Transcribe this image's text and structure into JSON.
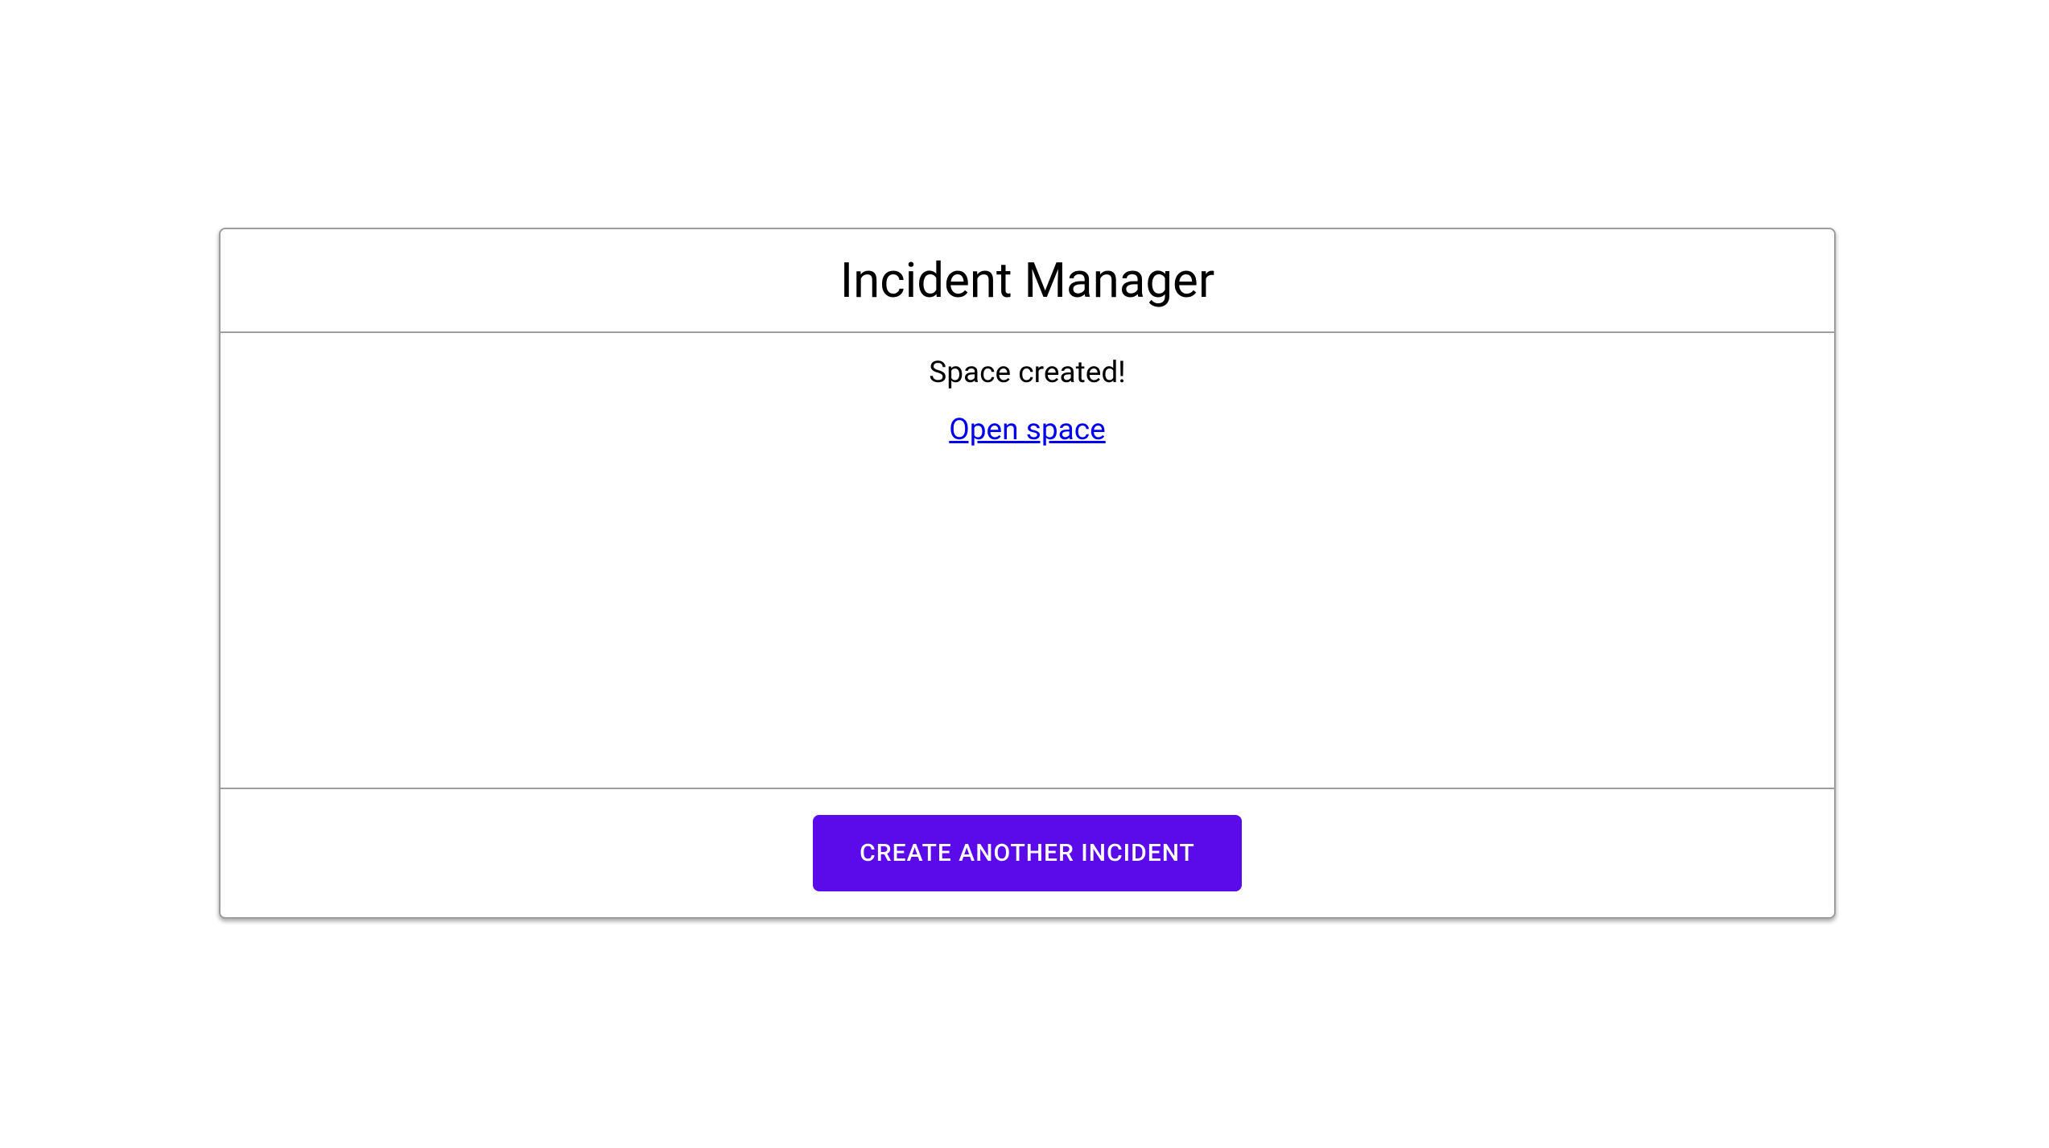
{
  "header": {
    "title": "Incident Manager"
  },
  "body": {
    "status_message": "Space created!",
    "link_text": "Open space"
  },
  "footer": {
    "button_label": "CREATE ANOTHER INCIDENT"
  }
}
